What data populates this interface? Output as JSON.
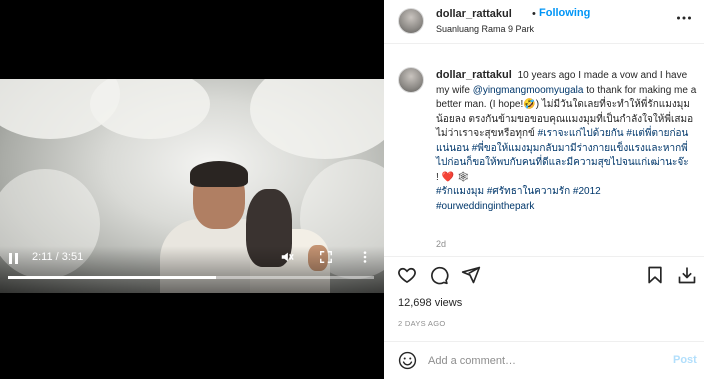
{
  "header": {
    "username": "dollar_rattakul",
    "separator": "•",
    "follow_label": "Following",
    "location": "Suanluang Rama 9 Park",
    "more_icon": "more-horizontal-icon"
  },
  "video": {
    "current_time": "2:11",
    "time_separator": "/",
    "duration": "3:51",
    "progress": 0.567,
    "icons": [
      "pause-icon",
      "mute-icon",
      "fullscreen-icon",
      "more-vertical-icon"
    ]
  },
  "caption": {
    "username": "dollar_rattakul",
    "text_1": "10 years ago I made a vow and I have my wife",
    "mention": "@yingmangmoomyugala",
    "text_2": "to thank for making me a better man. (I hope!",
    "emoji_1": "🤣",
    "text_3": ") ไม่มีวันใดเลยที่จะทำให้พี่รักแมงมุมน้อยลง ตรงกันข้ามขอขอบคุณแมงมุมที่เป็นกำลังใจให้พี่เสมอไม่ว่าเราจะสุขหรือทุกข์",
    "hashtag_1": "#เราจะแก่ไปด้วยกัน",
    "hashtag_2": "#แต่พี่ตายก่อนแน่นอน",
    "hashtag_3": "#พี่ขอให้แมงมุมกลับมามีร่างกายแข็งแรงและหากพี่ไปก่อนก็ขอให้พบกับคนที่ดีและมีความสุขไปจนแก่เฒ่านะจ๊ะ",
    "line_end": "!",
    "emoji_2": "❤️",
    "emoji_3": "🕸",
    "hashtag_4": "#รักแมงมุม",
    "hashtag_5": "#ศรัทธาในความรัก",
    "hashtag_6": "#2012",
    "hashtag_7": "#ourweddinginthepark",
    "time_ago": "2d"
  },
  "actions": {
    "icons": [
      "heart-icon",
      "comment-icon",
      "share-icon",
      "bookmark-icon",
      "download-icon"
    ],
    "views": "12,698 views",
    "date": "2 DAYS AGO"
  },
  "comment": {
    "placeholder": "Add a comment…",
    "post_label": "Post",
    "emoji_icon": "smiley-icon"
  },
  "colors": {
    "link": "#00376b",
    "accent": "#0095f6",
    "post_disabled": "#b2dffc",
    "muted": "#8e8e8e"
  }
}
